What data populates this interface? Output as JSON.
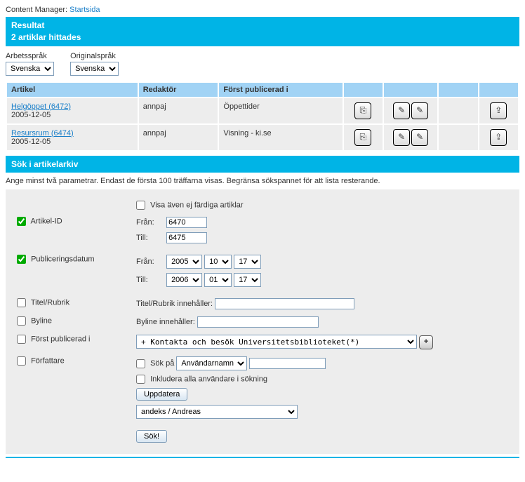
{
  "breadcrumb": {
    "prefix": "Content Manager:",
    "link": "Startsida"
  },
  "result_header": {
    "title": "Resultat",
    "subtitle": "2 artiklar hittades"
  },
  "lang": {
    "work_label": "Arbetsspråk",
    "orig_label": "Originalspråk",
    "work_value": "Svenska",
    "orig_value": "Svenska"
  },
  "table": {
    "headers": {
      "article": "Artikel",
      "editor": "Redaktör",
      "published": "Först publicerad i"
    },
    "rows": [
      {
        "title": "Helgöppet (6472)",
        "date": "2005-12-05",
        "editor": "annpaj",
        "published": "Öppettider"
      },
      {
        "title": "Resursrum (6474)",
        "date": "2005-12-05",
        "editor": "annpaj",
        "published": "Visning - ki.se"
      }
    ]
  },
  "search_header": "Sök i artikelarkiv",
  "instructions": "Ange minst två parametrar. Endast de första 100 träffarna visas. Begränsa sökspannet för att lista resterande.",
  "form": {
    "show_unfinished": "Visa även ej färdiga artiklar",
    "article_id": {
      "label": "Artikel-ID",
      "from_label": "Från:",
      "to_label": "Till:",
      "from": "6470",
      "to": "6475"
    },
    "pubdate": {
      "label": "Publiceringsdatum",
      "from_label": "Från:",
      "to_label": "Till:",
      "from": {
        "y": "2005",
        "m": "10",
        "d": "17"
      },
      "to": {
        "y": "2006",
        "m": "01",
        "d": "17"
      }
    },
    "title": {
      "chk": "Titel/Rubrik",
      "label": "Titel/Rubrik innehåller:"
    },
    "byline": {
      "chk": "Byline",
      "label": "Byline innehåller:"
    },
    "firstpub": {
      "chk": "Först publicerad i",
      "value": "+ Kontakta och besök Universitetsbiblioteket(*)"
    },
    "author": {
      "chk": "Författare",
      "searchon": "Sök på",
      "searchon_value": "Användarnamn",
      "include_all": "Inkludera alla användare i sökning",
      "update": "Uppdatera",
      "user_value": "andeks / Andreas"
    },
    "submit": "Sök!"
  }
}
